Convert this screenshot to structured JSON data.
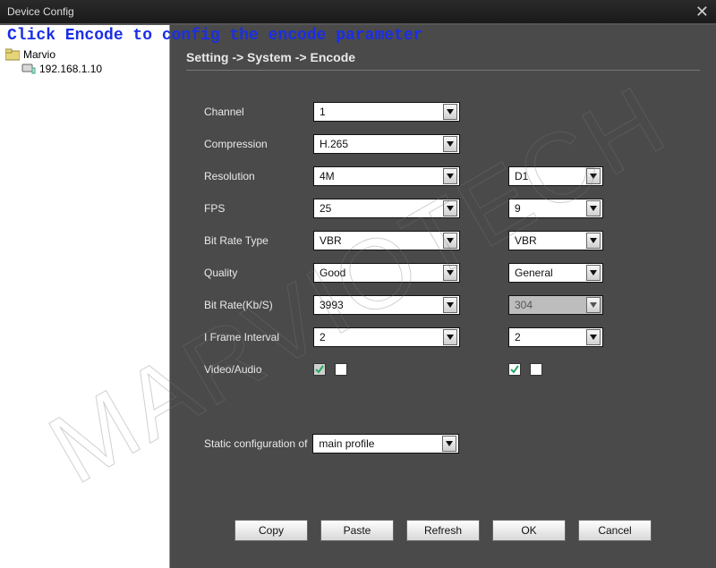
{
  "window": {
    "title": "Device Config"
  },
  "annotation": "Click Encode to config the encode parameter",
  "sidebar": {
    "root": "Marvio",
    "device": "192.168.1.10"
  },
  "breadcrumb": "Setting -> System -> Encode",
  "form": {
    "channel": {
      "label": "Channel",
      "main": "1"
    },
    "compression": {
      "label": "Compression",
      "main": "H.265"
    },
    "resolution": {
      "label": "Resolution",
      "main": "4M",
      "sub": "D1"
    },
    "fps": {
      "label": "FPS",
      "main": "25",
      "sub": "9"
    },
    "bitrate_type": {
      "label": "Bit Rate Type",
      "main": "VBR",
      "sub": "VBR"
    },
    "quality": {
      "label": "Quality",
      "main": "Good",
      "sub": "General"
    },
    "bitrate": {
      "label": "Bit Rate(Kb/S)",
      "main": "3993",
      "sub": "304"
    },
    "iframe": {
      "label": "I Frame Interval",
      "main": "2",
      "sub": "2"
    },
    "video_audio": {
      "label": "Video/Audio",
      "main_video": true,
      "main_audio": false,
      "sub_video": true,
      "sub_audio": false
    }
  },
  "static_cfg": {
    "label": "Static configuration of",
    "value": "main profile"
  },
  "buttons": {
    "copy": "Copy",
    "paste": "Paste",
    "refresh": "Refresh",
    "ok": "OK",
    "cancel": "Cancel"
  },
  "watermark": "MARVIOTECH"
}
